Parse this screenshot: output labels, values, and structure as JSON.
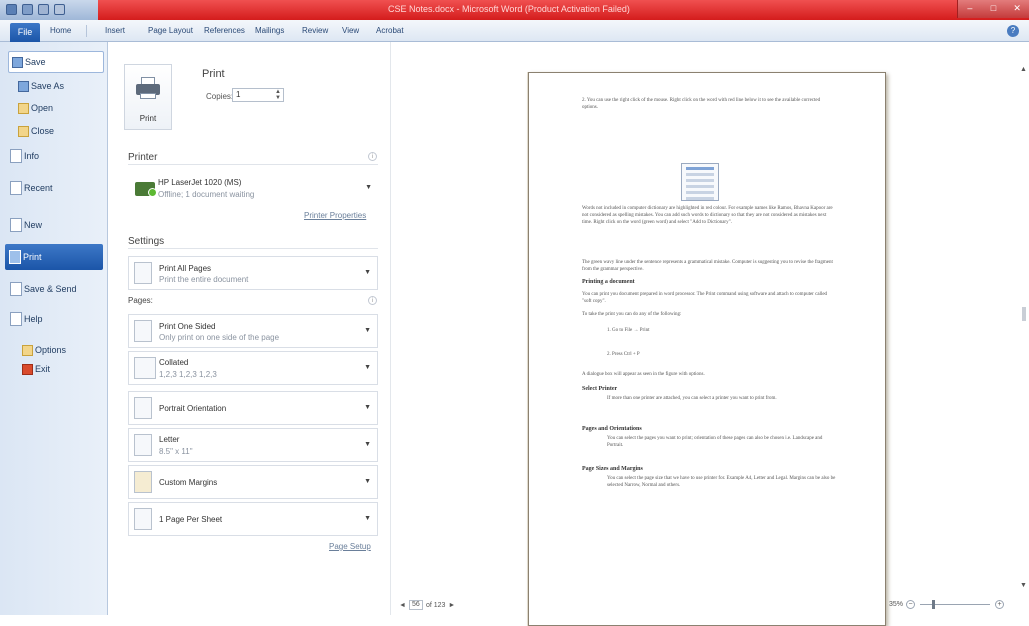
{
  "window": {
    "title": "CSE Notes.docx - Microsoft Word (Product Activation Failed)",
    "controls": [
      "–",
      "□",
      "✕"
    ],
    "help": "?"
  },
  "ribbon": {
    "file_tab": "File",
    "tabs": [
      "Home",
      "Insert",
      "Page Layout",
      "References",
      "Mailings",
      "Review",
      "View",
      "Acrobat"
    ]
  },
  "nav": {
    "save": "Save",
    "save_as": "Save As",
    "open": "Open",
    "close": "Close",
    "info": "Info",
    "recent": "Recent",
    "new": "New",
    "print": "Print",
    "save_send": "Save & Send",
    "help": "Help",
    "options": "Options",
    "exit": "Exit"
  },
  "print_panel": {
    "print_button": "Print",
    "title": "Print",
    "copies_label": "Copies:",
    "copies_value": "1",
    "printer_heading": "Printer",
    "printer_name": "HP LaserJet 1020 (MS)",
    "printer_status": "Offline; 1 document waiting",
    "printer_properties": "Printer Properties",
    "settings_heading": "Settings",
    "print_all_pages": "Print All Pages",
    "print_all_pages_sub": "Print the entire document",
    "pages_label": "Pages:",
    "print_one_sided": "Print One Sided",
    "print_one_sided_sub": "Only print on one side of the page",
    "collated": "Collated",
    "collated_sub": "1,2,3   1,2,3   1,2,3",
    "orientation": "Portrait Orientation",
    "paper": "Letter",
    "paper_sub": "8.5\" x 11\"",
    "margins": "Custom Margins",
    "pages_per_sheet": "1 Page Per Sheet",
    "page_setup": "Page Setup",
    "info_glyph": "i"
  },
  "preview": {
    "current_page": "56",
    "total_pages": "of 123",
    "zoom_level": "35%",
    "zoom_minus": "−",
    "zoom_plus": "+",
    "prev_arrow": "◄",
    "next_arrow": "►",
    "doc": {
      "p1": "2. You can use the right click of the mouse. Right click on the word with red line below it to see the available corrected options.",
      "p2": "Words not included in computer dictionary are highlighted in red colour. For example names like Ramos, Bhavna Kapoor are not considered as spelling mistakes. You can add such words to dictionary so that they are not considered as mistakes next time. Right click on the word (green word) and select \"Add to Dictionary\".",
      "p3": "The green wavy line under the sentence represents a grammatical mistake. Computer is suggesting you to revise the fragment from the grammar perspective.",
      "h1": "Printing a document",
      "p4": "You can print you document prepared in word processor. The Print command using software and attach to computer called \"soft copy\".",
      "p5": "To take the print you can do any of the following:",
      "li1": "1.  Go to File → Print",
      "li2": "2.  Press Ctrl + P",
      "p6": "A dialogue box will appear as seen in the figure with options.",
      "h2": "Select Printer",
      "p7": "If more than one printer are attached, you can select a printer you want to print from.",
      "h3": "Pages and Orientations",
      "p8": "You can select the pages you want to print; orientation of these pages can also be chosen i.e. Landscape and Portrait.",
      "h4": "Page Sizes and Margins",
      "p9": "You can select the page size that we have to use printer for. Example A4, Letter and Legal. Margins can be also be selected Narrow, Normal and others."
    }
  }
}
